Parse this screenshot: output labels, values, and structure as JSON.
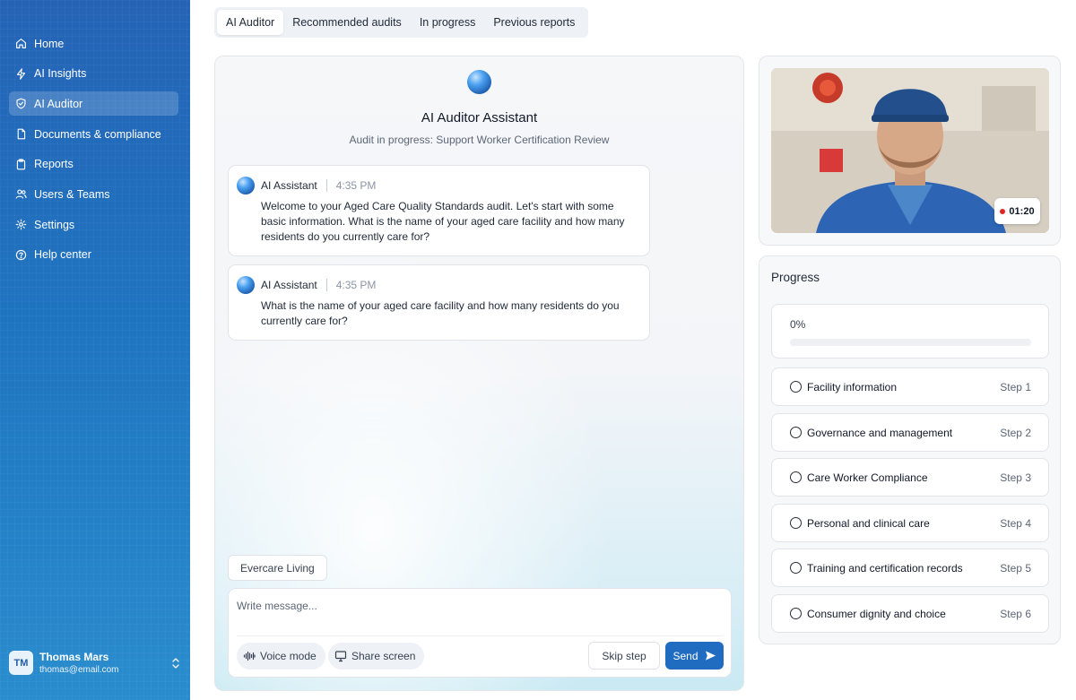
{
  "sidebar": {
    "items": [
      {
        "label": "Home",
        "icon": "home-icon"
      },
      {
        "label": "AI Insights",
        "icon": "lightning-icon"
      },
      {
        "label": "AI Auditor",
        "icon": "shield-check-icon",
        "active": true
      },
      {
        "label": "Documents & compliance",
        "icon": "document-icon"
      },
      {
        "label": "Reports",
        "icon": "clipboard-icon"
      },
      {
        "label": "Users & Teams",
        "icon": "users-icon"
      },
      {
        "label": "Settings",
        "icon": "gear-icon"
      },
      {
        "label": "Help center",
        "icon": "help-icon"
      }
    ],
    "user": {
      "initials": "TM",
      "name": "Thomas Mars",
      "email": "thomas@email.com"
    }
  },
  "tabs": [
    {
      "label": "AI Auditor",
      "active": true
    },
    {
      "label": "Recommended audits"
    },
    {
      "label": "In progress"
    },
    {
      "label": "Previous reports"
    }
  ],
  "chat": {
    "title": "AI Auditor Assistant",
    "subtitle": "Audit in progress: Support Worker Certification Review",
    "messages": [
      {
        "sender": "AI Assistant",
        "time": "4:35 PM",
        "text": "Welcome to your Aged Care Quality Standards audit. Let's start with some basic information. What is the name of your aged care facility and how many residents do you currently care for?"
      },
      {
        "sender": "AI Assistant",
        "time": "4:35 PM",
        "text": "What is the name of your aged care facility and how many residents do you currently care for?"
      }
    ],
    "suggestion": "Evercare Living",
    "composer": {
      "placeholder": "Write message...",
      "voice_label": "Voice mode",
      "share_label": "Share screen",
      "skip_label": "Skip step",
      "send_label": "Send"
    }
  },
  "video": {
    "timer": "01:20",
    "recording_color": "#e02424"
  },
  "progress": {
    "title": "Progress",
    "percent_label": "0%",
    "percent_value": 0,
    "steps": [
      {
        "label": "Facility information",
        "step": "Step 1"
      },
      {
        "label": "Governance and management",
        "step": "Step 2"
      },
      {
        "label": "Care Worker Compliance",
        "step": "Step 3"
      },
      {
        "label": "Personal and clinical care",
        "step": "Step 4"
      },
      {
        "label": "Training and certification records",
        "step": "Step 5"
      },
      {
        "label": "Consumer dignity and choice",
        "step": "Step 6"
      }
    ]
  },
  "colors": {
    "accent": "#1f6cc0",
    "sidebar_top": "#2563b6",
    "sidebar_bottom": "#2a8ccd"
  }
}
